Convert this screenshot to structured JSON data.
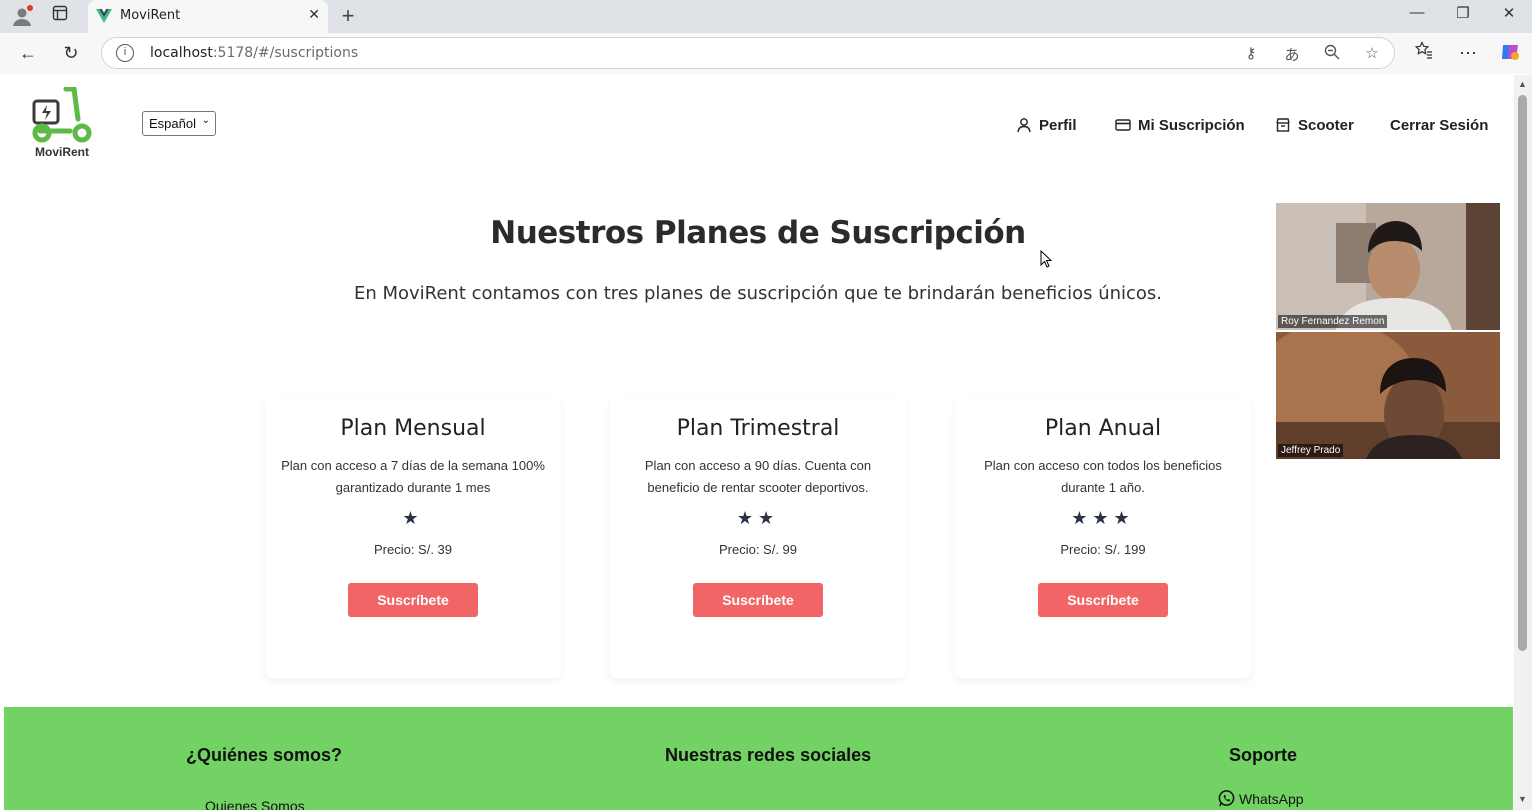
{
  "browser": {
    "tab_title": "MoviRent",
    "url_host": "localhost",
    "url_path": ":5178/#/suscriptions"
  },
  "header": {
    "brand": "MoviRent",
    "language": "Español",
    "nav": {
      "profile": "Perfil",
      "subscription": "Mi Suscripción",
      "scooter": "Scooter",
      "logout": "Cerrar Sesión"
    }
  },
  "main": {
    "title": "Nuestros Planes de Suscripción",
    "subtitle": "En MoviRent contamos con tres planes de suscripción que te brindarán beneficios únicos.",
    "plans": [
      {
        "name": "Plan Mensual",
        "description": "Plan con acceso a 7 días de la semana 100% garantizado durante 1 mes",
        "stars": "★",
        "price": "Precio: S/. 39",
        "button": "Suscríbete"
      },
      {
        "name": "Plan Trimestral",
        "description": "Plan con acceso a 90 días. Cuenta con beneficio de rentar scooter deportivos.",
        "stars": "★★",
        "price": "Precio: S/. 99",
        "button": "Suscríbete"
      },
      {
        "name": "Plan Anual",
        "description": "Plan con acceso con todos los beneficios durante 1 año.",
        "stars": "★★★",
        "price": "Precio: S/. 199",
        "button": "Suscríbete"
      }
    ]
  },
  "video_call": {
    "participants": [
      "Roy Fernandez Remon",
      "Jeffrey Prado"
    ]
  },
  "footer": {
    "about_title": "¿Quiénes somos?",
    "about_link": "Quienes Somos",
    "social_title": "Nuestras redes sociales",
    "support_title": "Soporte",
    "support_link": "WhatsApp"
  },
  "colors": {
    "accent_green": "#72d263",
    "button_red": "#f26566"
  }
}
